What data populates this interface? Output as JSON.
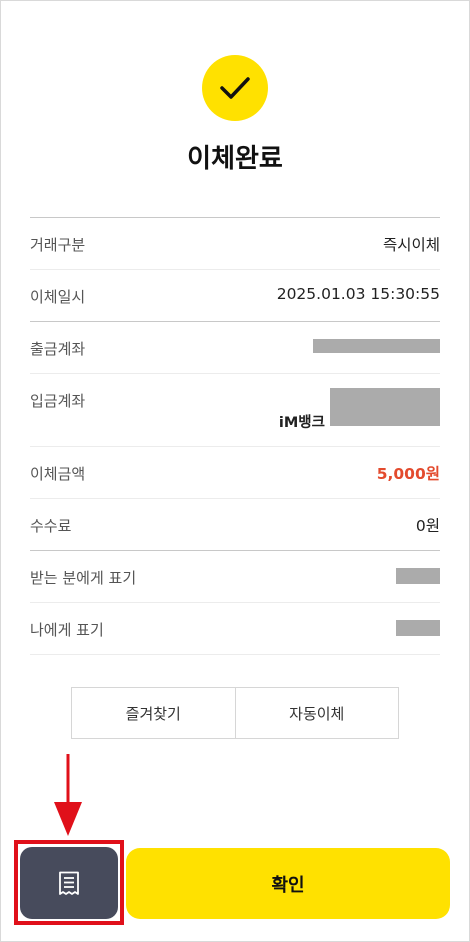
{
  "title": "이체완료",
  "details": {
    "transfer_type": {
      "label": "거래구분",
      "value": "즉시이체"
    },
    "transfer_datetime": {
      "label": "이체일시",
      "value": "2025.01.03 15:30:55"
    },
    "withdraw_account": {
      "label": "출금계좌",
      "value": ""
    },
    "deposit_account": {
      "label": "입금계좌",
      "bank": "iM뱅크",
      "value": ""
    },
    "amount": {
      "label": "이체금액",
      "value": "5,000원"
    },
    "fee": {
      "label": "수수료",
      "value": "0원"
    },
    "recipient_memo": {
      "label": "받는 분에게 표기",
      "value": ""
    },
    "my_memo": {
      "label": "나에게 표기",
      "value": ""
    }
  },
  "actions": {
    "favorite_label": "즐겨찾기",
    "auto_transfer_label": "자동이체",
    "confirm_label": "확인"
  },
  "icons": {
    "status": "check-icon",
    "receipt": "receipt-icon"
  },
  "colors": {
    "brand_yellow": "#FFE100",
    "amount_red": "#E34B2E",
    "receipt_button": "#474B5C",
    "highlight": "#E0101A"
  }
}
